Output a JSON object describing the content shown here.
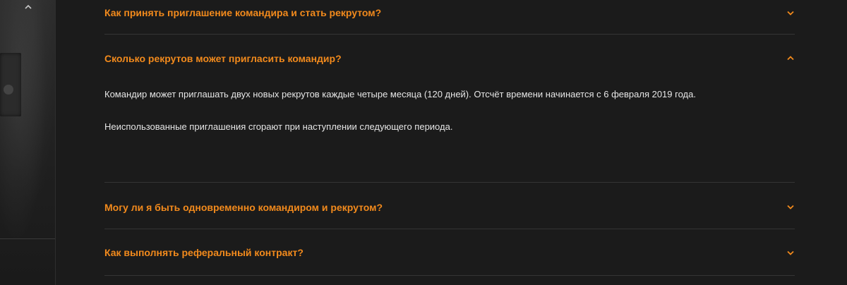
{
  "nav": {
    "scroll_up_icon": "chevron-up-icon"
  },
  "faq": {
    "items": [
      {
        "question": "Как принять приглашение командира и стать рекрутом?",
        "state": "collapsed"
      },
      {
        "question": "Сколько рекрутов может пригласить командир?",
        "state": "expanded",
        "answer": [
          "Командир может приглашать двух новых рекрутов каждые четыре месяца (120 дней). Отсчёт времени начинается с 6 февраля 2019 года.",
          "Неиспользованные приглашения сгорают при наступлении следующего периода."
        ]
      },
      {
        "question": "Могу ли я быть одновременно командиром и рекрутом?",
        "state": "collapsed"
      },
      {
        "question": "Как выполнять реферальный контракт?",
        "state": "collapsed"
      }
    ]
  },
  "colors": {
    "accent": "#f28a1c",
    "background": "#1b1b1b",
    "divider": "#353535",
    "text": "#e6e6e6"
  }
}
